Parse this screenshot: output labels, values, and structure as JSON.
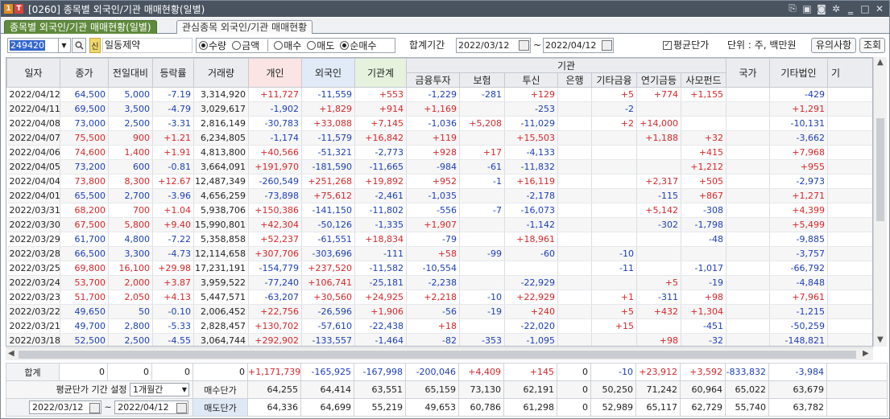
{
  "window": {
    "badge1": "1",
    "badge2": "T",
    "title": "[0260] 종목별 외국인/기관 매매현황(일별)"
  },
  "tabs": [
    {
      "label": "종목별 외국인/기관 매매현황(일별)"
    },
    {
      "label": "관심종목 외국인/기관 매매현황"
    }
  ],
  "toolbar": {
    "code": "249420",
    "name_badge": "신",
    "stock_name": "일동제약",
    "radio_qty": "수량",
    "radio_amt": "금액",
    "radio_buy": "매수",
    "radio_sell": "매도",
    "radio_net": "순매수",
    "selected_radios": [
      "수량",
      "순매수"
    ],
    "range_label": "합계기간",
    "date_from": "2022/03/12",
    "tilde": "~",
    "date_to": "2022/04/12",
    "avg_label": "평균단가",
    "avg_checked": true,
    "unit": "단위 : 주, 백만원",
    "notice_button": "유의사항",
    "query_button": "조회"
  },
  "table": {
    "headers": {
      "date": "일자",
      "price": "종가",
      "change": "전일대비",
      "rate": "등락률",
      "volume": "거래량",
      "individual": "개인",
      "foreign": "외국인",
      "inst_total": "기관계",
      "inst_group": "기관",
      "finance": "금융투자",
      "insurance": "보험",
      "trust": "투신",
      "bank": "은행",
      "other_fin": "기타금융",
      "pension": "연기금등",
      "private_fund": "사모펀드",
      "nation": "국가",
      "other_corp": "기타법인",
      "cut": "기"
    },
    "rows": [
      [
        "2022/04/12",
        "64,500",
        "5,000",
        "-7.19",
        "3,314,920",
        "+11,727",
        "-11,559",
        "+553",
        "-1,229",
        "-281",
        "+129",
        "",
        "+5",
        "+774",
        "+1,155",
        "",
        "-429"
      ],
      [
        "2022/04/11",
        "69,500",
        "3,500",
        "-4.79",
        "3,029,617",
        "-1,902",
        "+1,829",
        "+914",
        "+1,169",
        "",
        "-253",
        "",
        "-2",
        "",
        "",
        "",
        "+1,291"
      ],
      [
        "2022/04/08",
        "73,000",
        "2,500",
        "-3.31",
        "2,816,149",
        "-30,783",
        "+33,088",
        "+7,145",
        "-1,036",
        "+5,208",
        "-11,029",
        "",
        "+2",
        "+14,000",
        "",
        "",
        "-10,131"
      ],
      [
        "2022/04/07",
        "75,500",
        "900",
        "+1.21",
        "6,234,805",
        "-1,174",
        "-11,579",
        "+16,842",
        "+119",
        "",
        "+15,503",
        "",
        "",
        "+1,188",
        "+32",
        "",
        "-3,662"
      ],
      [
        "2022/04/06",
        "74,600",
        "1,400",
        "+1.91",
        "4,813,800",
        "+40,566",
        "-51,321",
        "-2,773",
        "+928",
        "+17",
        "-4,133",
        "",
        "",
        "",
        "+415",
        "",
        "+7,968"
      ],
      [
        "2022/04/05",
        "73,200",
        "600",
        "-0.81",
        "3,664,091",
        "+191,970",
        "-181,590",
        "-11,665",
        "-984",
        "-61",
        "-11,832",
        "",
        "",
        "",
        "+1,212",
        "",
        "+955"
      ],
      [
        "2022/04/04",
        "73,800",
        "8,300",
        "+12.67",
        "12,487,349",
        "-260,549",
        "+251,268",
        "+19,892",
        "+952",
        "-1",
        "+16,119",
        "",
        "",
        "+2,317",
        "+505",
        "",
        "-2,973"
      ],
      [
        "2022/04/01",
        "65,500",
        "2,700",
        "-3.96",
        "4,656,259",
        "-73,898",
        "+75,612",
        "-2,461",
        "-1,035",
        "",
        "-2,178",
        "",
        "",
        "-115",
        "+867",
        "",
        "+1,271"
      ],
      [
        "2022/03/31",
        "68,200",
        "700",
        "+1.04",
        "5,938,706",
        "+150,386",
        "-141,150",
        "-11,802",
        "-556",
        "-7",
        "-16,073",
        "",
        "",
        "+5,142",
        "-308",
        "",
        "+4,399"
      ],
      [
        "2022/03/30",
        "67,500",
        "5,800",
        "+9.40",
        "15,990,801",
        "+42,304",
        "-50,126",
        "-1,335",
        "+1,907",
        "",
        "-1,142",
        "",
        "",
        "-302",
        "-1,798",
        "",
        "+5,499"
      ],
      [
        "2022/03/29",
        "61,700",
        "4,800",
        "-7.22",
        "5,358,858",
        "+52,237",
        "-61,551",
        "+18,834",
        "-79",
        "",
        "+18,961",
        "",
        "",
        "",
        "-48",
        "",
        "-9,885"
      ],
      [
        "2022/03/28",
        "66,500",
        "3,300",
        "-4.73",
        "12,114,658",
        "+307,706",
        "-303,696",
        "-111",
        "+58",
        "-99",
        "-60",
        "",
        "-10",
        "",
        "",
        "",
        "-3,757"
      ],
      [
        "2022/03/25",
        "69,800",
        "16,100",
        "+29.98",
        "17,231,191",
        "-154,779",
        "+237,520",
        "-11,582",
        "-10,554",
        "",
        "",
        "",
        "-11",
        "",
        "-1,017",
        "",
        "-66,792"
      ],
      [
        "2022/03/24",
        "53,700",
        "2,000",
        "+3.87",
        "3,959,522",
        "-77,240",
        "+106,741",
        "-25,181",
        "-2,238",
        "",
        "-22,929",
        "",
        "",
        "+5",
        "-19",
        "",
        "-4,848"
      ],
      [
        "2022/03/23",
        "51,700",
        "2,050",
        "+4.13",
        "5,447,571",
        "-63,207",
        "+30,560",
        "+24,925",
        "+2,218",
        "-10",
        "+22,929",
        "",
        "+1",
        "-311",
        "+98",
        "",
        "+7,961"
      ],
      [
        "2022/03/22",
        "49,650",
        "50",
        "-0.10",
        "2,006,452",
        "+22,756",
        "-26,596",
        "+1,906",
        "-56",
        "-19",
        "+240",
        "",
        "+5",
        "+432",
        "+1,304",
        "",
        "-1,215"
      ],
      [
        "2022/03/21",
        "49,700",
        "2,800",
        "-5.33",
        "2,828,457",
        "+130,702",
        "-57,610",
        "-22,438",
        "+18",
        "",
        "-22,020",
        "",
        "+15",
        "",
        "-451",
        "",
        "-50,259"
      ],
      [
        "2022/03/18",
        "52,500",
        "2,500",
        "-4.55",
        "3,064,744",
        "+292,902",
        "-133,557",
        "-1,464",
        "-82",
        "-353",
        "-1,095",
        "",
        "",
        "+98",
        "-32",
        "",
        "-148,821"
      ]
    ],
    "change_colors": [
      "b",
      "b",
      "b",
      "r",
      "r",
      "b",
      "r",
      "b",
      "r",
      "r",
      "b",
      "b",
      "r",
      "r",
      "r",
      "b",
      "b",
      "b"
    ]
  },
  "summary": {
    "total_label": "합계",
    "total_values": [
      "0",
      "0",
      "0",
      "0",
      "+1,171,739",
      "-165,925",
      "-167,998",
      "-200,046",
      "+4,409",
      "+145",
      "0",
      "-10",
      "+23,912",
      "+3,592",
      "-833,832",
      "-3,984"
    ],
    "avg_period_label": "평균단가 기간 설정",
    "avg_period_value": "1개월간",
    "buy_label": "매수단가",
    "buy_values": [
      "64,255",
      "64,414",
      "63,551",
      "65,159",
      "73,130",
      "62,191",
      "0",
      "50,250",
      "71,242",
      "60,964",
      "65,022",
      "63,679"
    ],
    "sell_label": "매도단가",
    "sell_values": [
      "64,336",
      "64,699",
      "55,219",
      "49,653",
      "60,786",
      "61,298",
      "0",
      "52,989",
      "65,117",
      "62,729",
      "55,740",
      "63,782"
    ],
    "period_from": "2022/03/12",
    "period_to": "2022/04/12"
  },
  "colors": {
    "up": "#d7262a",
    "down": "#1c3eb8",
    "title_bg": "#4a5461",
    "active_tab": "#5f8a3c"
  }
}
